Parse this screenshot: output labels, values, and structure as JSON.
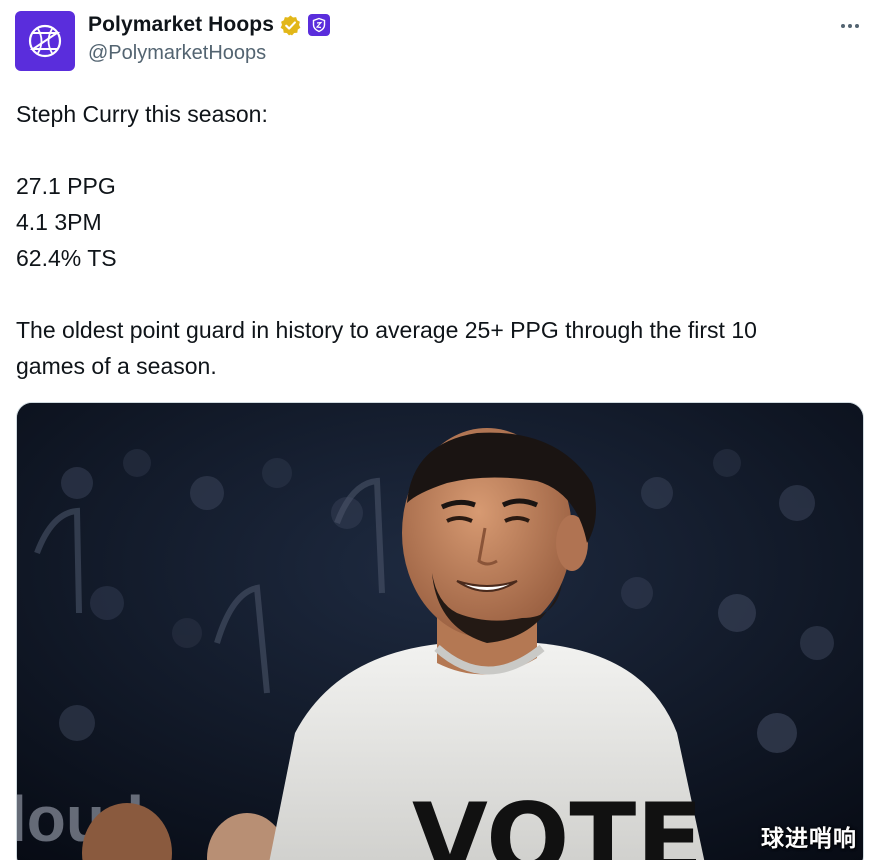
{
  "author": {
    "display_name": "Polymarket Hoops",
    "handle": "@PolymarketHoops",
    "avatar_icon": "basketball-globe-icon",
    "verified_icon": "gold-verified-badge-icon",
    "affiliate_icon": "affiliate-shield-icon",
    "brand_color": "#5a2ddc",
    "verified_color": "#e2b719"
  },
  "actions": {
    "more_icon": "more-options-icon"
  },
  "tweet": {
    "lines": [
      "Steph Curry this season:",
      "",
      "27.1 PPG",
      "4.1 3PM",
      "62.4% TS",
      "",
      "The oldest point guard in history to average 25+ PPG through the first 10",
      "games of a season."
    ]
  },
  "media": {
    "image_subject": "smiling-basketball-player-photo",
    "shirt_text": "VOTE",
    "watermark": "球进哨响"
  }
}
